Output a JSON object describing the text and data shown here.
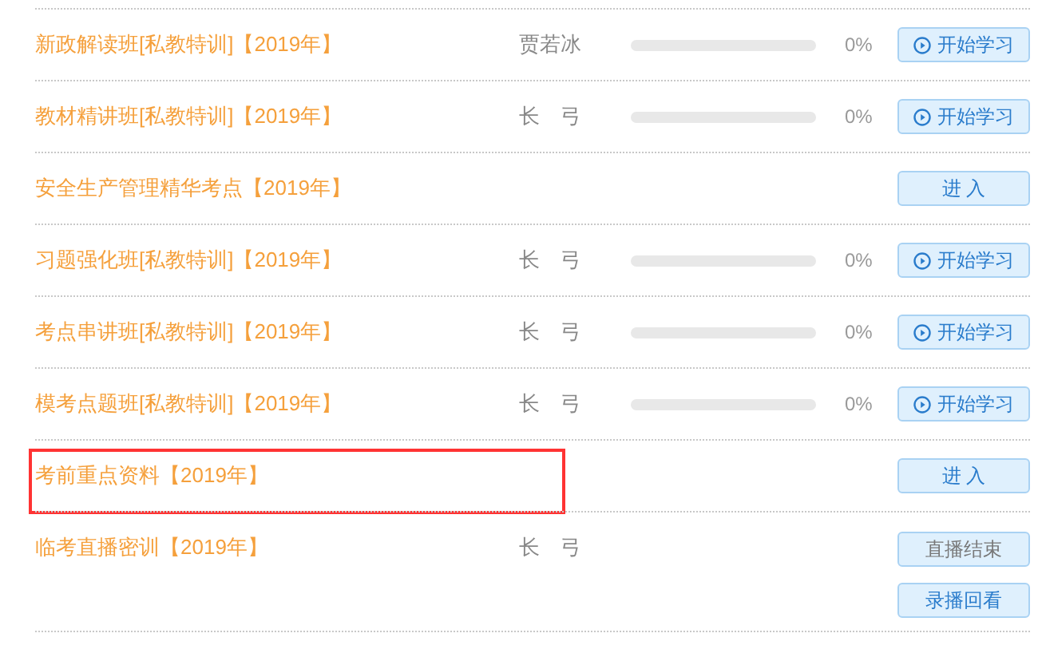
{
  "rows": [
    {
      "kind": "course",
      "title": "新政解读班[私教特训]【2019年】",
      "teacher": "贾若冰",
      "percent": "0%",
      "highlighted": false,
      "buttons": [
        {
          "kind": "play",
          "label": "开始学习",
          "muted": false
        }
      ]
    },
    {
      "kind": "course",
      "title": "教材精讲班[私教特训]【2019年】",
      "teacher": "长　弓",
      "percent": "0%",
      "highlighted": false,
      "buttons": [
        {
          "kind": "play",
          "label": "开始学习",
          "muted": false
        }
      ]
    },
    {
      "kind": "material",
      "title": "安全生产管理精华考点【2019年】",
      "highlighted": false,
      "buttons": [
        {
          "kind": "plain",
          "label": "进 入",
          "muted": false
        }
      ]
    },
    {
      "kind": "course",
      "title": "习题强化班[私教特训]【2019年】",
      "teacher": "长　弓",
      "percent": "0%",
      "highlighted": false,
      "buttons": [
        {
          "kind": "play",
          "label": "开始学习",
          "muted": false
        }
      ]
    },
    {
      "kind": "course",
      "title": "考点串讲班[私教特训]【2019年】",
      "teacher": "长　弓",
      "percent": "0%",
      "highlighted": false,
      "buttons": [
        {
          "kind": "play",
          "label": "开始学习",
          "muted": false
        }
      ]
    },
    {
      "kind": "course",
      "title": "模考点题班[私教特训]【2019年】",
      "teacher": "长　弓",
      "percent": "0%",
      "highlighted": false,
      "buttons": [
        {
          "kind": "play",
          "label": "开始学习",
          "muted": false
        }
      ]
    },
    {
      "kind": "material",
      "title": "考前重点资料【2019年】",
      "highlighted": true,
      "buttons": [
        {
          "kind": "plain",
          "label": "进 入",
          "muted": false
        }
      ]
    },
    {
      "kind": "live",
      "title": "临考直播密训【2019年】",
      "teacher": "长　弓",
      "highlighted": false,
      "buttons": [
        {
          "kind": "plain",
          "label": "直播结束",
          "muted": true
        },
        {
          "kind": "plain",
          "label": "录播回看",
          "muted": false
        }
      ]
    }
  ]
}
